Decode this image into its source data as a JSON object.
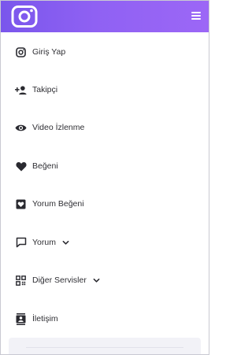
{
  "header": {
    "logo_icon": "instagram-logo-icon",
    "menu_icon": "hamburger-menu-icon",
    "gradient_colors": [
      "#7a56ec",
      "#9c67f6"
    ]
  },
  "menu": {
    "items": [
      {
        "label": "Giriş Yap",
        "icon": "instagram-icon"
      },
      {
        "label": "Takipçi",
        "icon": "add-user-icon"
      },
      {
        "label": "Video İzlenme",
        "icon": "eye-icon"
      },
      {
        "label": "Beğeni",
        "icon": "heart-icon"
      },
      {
        "label": "Yorum Beğeni",
        "icon": "heart-box-icon"
      },
      {
        "label": "Yorum",
        "icon": "comment-icon",
        "has_dropdown": true
      },
      {
        "label": "Diğer Servisler",
        "icon": "grid-icon",
        "has_dropdown": true
      },
      {
        "label": "İletişim",
        "icon": "contact-card-icon"
      }
    ]
  },
  "colors": {
    "text": "#2f2f34",
    "icon": "#2a2a30"
  }
}
